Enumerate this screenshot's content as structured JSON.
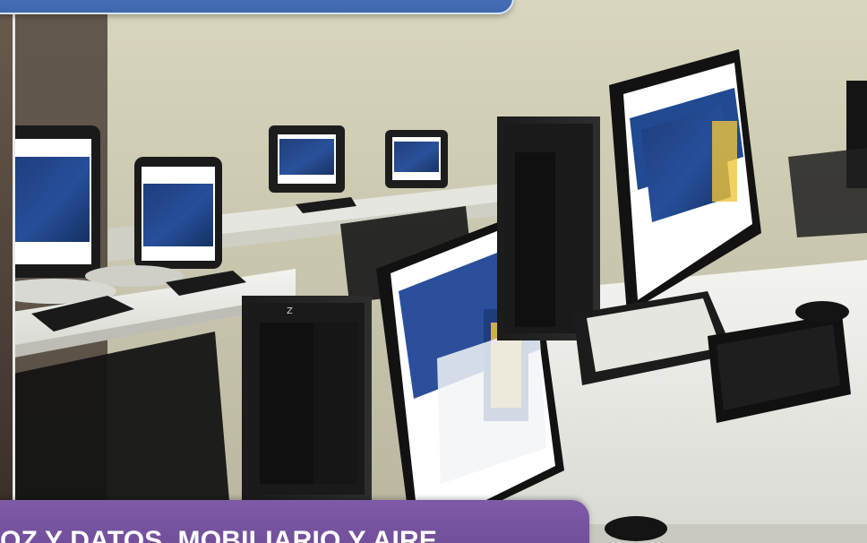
{
  "caption": {
    "text": "OZ Y DATOS, MOBILIARIO Y AIRE"
  },
  "colors": {
    "top_banner": "#3f67ad",
    "caption_banner": "#6c4b95",
    "caption_text": "#ffffff"
  }
}
